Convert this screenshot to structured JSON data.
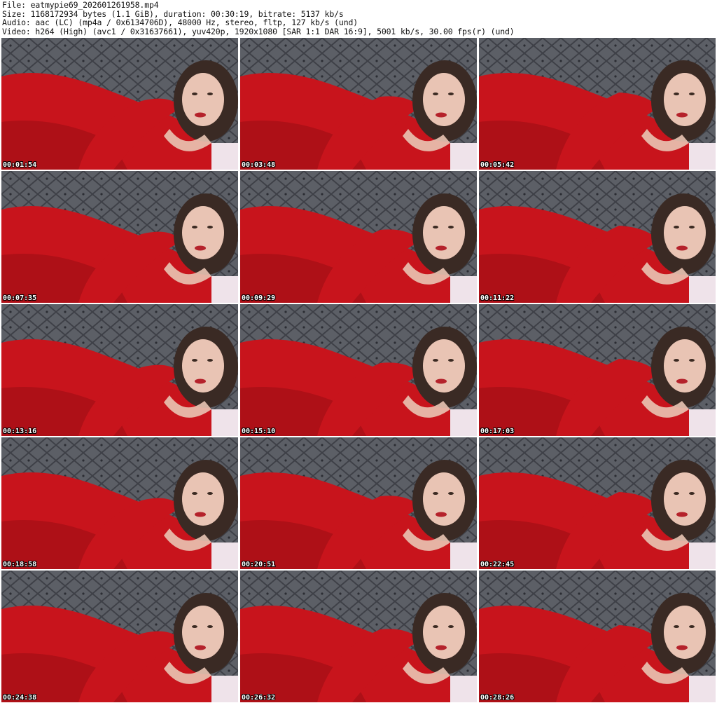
{
  "header": {
    "file": "File: eatmypie69_202601261958.mp4",
    "size": "Size: 1168172934 bytes (1.1 GiB), duration: 00:30:19, bitrate: 5137 kb/s",
    "audio": "Audio: aac (LC) (mp4a / 0x6134706D), 48000 Hz, stereo, fltp, 127 kb/s (und)",
    "video": "Video: h264 (High) (avc1 / 0x31637661), yuv420p, 1920x1080 [SAR 1:1 DAR 16:9], 5001 kb/s, 30.00 fps(r) (und)"
  },
  "colors": {
    "headboard": "#5c5f66",
    "tufting": "#3e4047",
    "dress": "#c8141c",
    "dress_shadow": "#8e0c12",
    "skin": "#e9c4b4",
    "hair": "#3a2a24",
    "sheet": "#efe3ea"
  },
  "thumbnails": [
    {
      "timestamp": "00:01:54"
    },
    {
      "timestamp": "00:03:48"
    },
    {
      "timestamp": "00:05:42"
    },
    {
      "timestamp": "00:07:35"
    },
    {
      "timestamp": "00:09:29"
    },
    {
      "timestamp": "00:11:22"
    },
    {
      "timestamp": "00:13:16"
    },
    {
      "timestamp": "00:15:10"
    },
    {
      "timestamp": "00:17:03"
    },
    {
      "timestamp": "00:18:58"
    },
    {
      "timestamp": "00:20:51"
    },
    {
      "timestamp": "00:22:45"
    },
    {
      "timestamp": "00:24:38"
    },
    {
      "timestamp": "00:26:32"
    },
    {
      "timestamp": "00:28:26"
    }
  ]
}
